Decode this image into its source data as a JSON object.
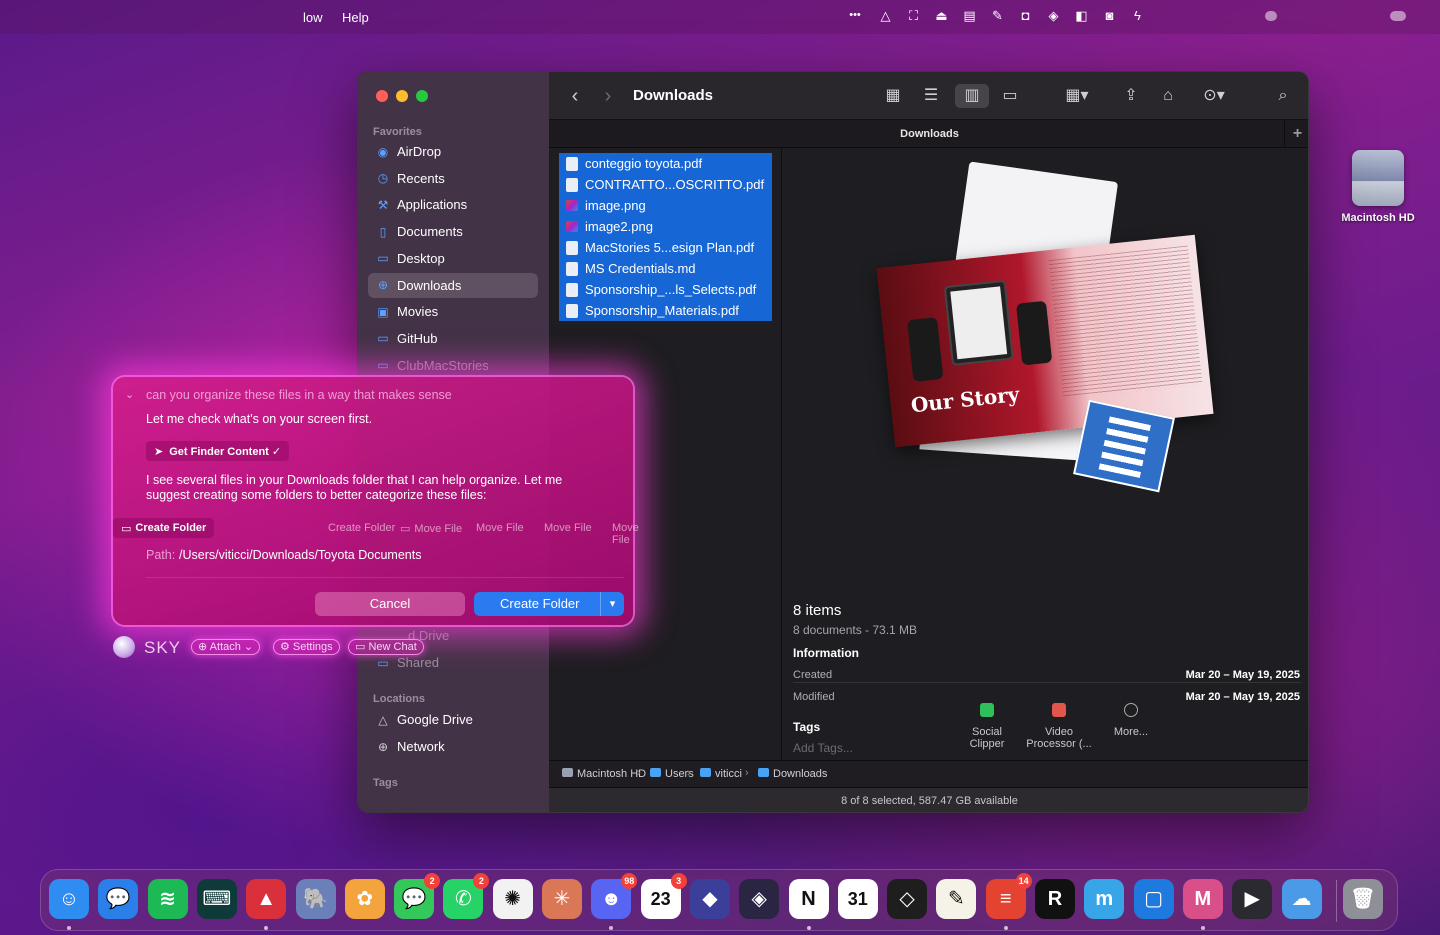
{
  "menubar": {
    "items": [
      "low",
      "Help"
    ],
    "status_icons": [
      "more-icon",
      "drive-icon",
      "screenshot-icon",
      "tray-icon",
      "clapper-icon",
      "pen-icon",
      "shield-icon",
      "layers-icon",
      "bag-icon",
      "camera-icon",
      "bolt-icon"
    ]
  },
  "finder": {
    "title": "Downloads",
    "tab_title": "Downloads",
    "tab_add": "+",
    "sidebar": {
      "favorites_label": "Favorites",
      "favorites": [
        {
          "label": "AirDrop",
          "icon": "airdrop-icon"
        },
        {
          "label": "Recents",
          "icon": "clock-icon"
        },
        {
          "label": "Applications",
          "icon": "applications-icon"
        },
        {
          "label": "Documents",
          "icon": "document-icon"
        },
        {
          "label": "Desktop",
          "icon": "desktop-icon"
        },
        {
          "label": "Downloads",
          "icon": "downloads-icon"
        },
        {
          "label": "Movies",
          "icon": "movies-icon"
        },
        {
          "label": "GitHub",
          "icon": "folder-icon"
        },
        {
          "label": "ClubMacStories",
          "icon": "folder-icon"
        }
      ],
      "partial_drive": "d Drive",
      "shared": "Shared",
      "locations_label": "Locations",
      "locations": [
        {
          "label": "Google Drive",
          "icon": "drive-icon"
        },
        {
          "label": "Network",
          "icon": "globe-icon"
        }
      ],
      "tags_label": "Tags"
    },
    "files": [
      {
        "name": "conteggio toyota.pdf",
        "kind": "pdf"
      },
      {
        "name": "CONTRATTO...OSCRITTO.pdf",
        "kind": "pdf"
      },
      {
        "name": "image.png",
        "kind": "img"
      },
      {
        "name": "image2.png",
        "kind": "img"
      },
      {
        "name": "MacStories 5...esign Plan.pdf",
        "kind": "pdf"
      },
      {
        "name": "MS Credentials.md",
        "kind": "pdf"
      },
      {
        "name": "Sponsorship_...ls_Selects.pdf",
        "kind": "pdf"
      },
      {
        "name": "Sponsorship_Materials.pdf",
        "kind": "pdf"
      }
    ],
    "preview": {
      "cover_title": "Our Story",
      "items_count": "8 items",
      "items_detail": "8 documents - 73.1 MB",
      "information_label": "Information",
      "created_label": "Created",
      "created_value": "Mar 20 – May 19, 2025",
      "modified_label": "Modified",
      "modified_value": "Mar 20 – May 19, 2025",
      "tags_label": "Tags",
      "tags_placeholder": "Add Tags...",
      "actions": [
        {
          "label1": "Social",
          "label2": "Clipper",
          "color": "#2fbf5b"
        },
        {
          "label1": "Video",
          "label2": "Processor (...",
          "color": "#e2554d"
        },
        {
          "label1": "More...",
          "label2": "",
          "color": "#8a8a8e"
        }
      ]
    },
    "path": [
      "Macintosh HD",
      "Users",
      "viticci",
      "Downloads"
    ],
    "status": "8 of 8 selected, 587.47 GB available"
  },
  "desktop": {
    "hd_label": "Macintosh HD"
  },
  "sky": {
    "prompt": "can you organize these files in a way that makes sense",
    "msg1": "Let me check what's on your screen first.",
    "tool_call": "Get Finder Content ✓",
    "msg2_line1": "I see several files in your Downloads folder that I can help organize. Let me",
    "msg2_line2": "suggest creating some folders to better categorize these files:",
    "actions": [
      "Create Folder",
      "Create Folder",
      "Move File",
      "Move File",
      "Move File",
      "Move File"
    ],
    "path_label": "Path:",
    "path_value": "/Users/viticci/Downloads/Toyota Documents",
    "cancel": "Cancel",
    "confirm": "Create Folder",
    "brand": "SKY",
    "attach": "Attach",
    "settings": "Settings",
    "new_chat": "New Chat"
  },
  "dock": {
    "apps": [
      {
        "name": "finder",
        "glyph": "☺",
        "color": "#2f8cf0"
      },
      {
        "name": "messages-alt",
        "glyph": "💬",
        "color": "#2a7fe8"
      },
      {
        "name": "spotify",
        "glyph": "≋",
        "color": "#1db954"
      },
      {
        "name": "terminal",
        "glyph": "⌨",
        "color": "#0f3a3a"
      },
      {
        "name": "git",
        "glyph": "▲",
        "color": "#d9303c"
      },
      {
        "name": "tableplus",
        "glyph": "🐘",
        "color": "#6b7fb8"
      },
      {
        "name": "photos",
        "glyph": "✿",
        "color": "#f3a43c"
      },
      {
        "name": "messages",
        "glyph": "💬",
        "color": "#34c759",
        "badge": "2"
      },
      {
        "name": "whatsapp",
        "glyph": "✆",
        "color": "#25d366",
        "badge": "2"
      },
      {
        "name": "chatgpt",
        "glyph": "✺",
        "color": "#f2f2f2"
      },
      {
        "name": "claude",
        "glyph": "✳",
        "color": "#d97757"
      },
      {
        "name": "discord",
        "glyph": "☻",
        "color": "#5865f2",
        "badge": "98"
      },
      {
        "name": "calendar",
        "glyph": "23",
        "color": "#ffffff",
        "badge": "3"
      },
      {
        "name": "shortcuts",
        "glyph": "◆",
        "color": "#3b3f9a"
      },
      {
        "name": "obsidian",
        "glyph": "◈",
        "color": "#2b2544"
      },
      {
        "name": "notion",
        "glyph": "N",
        "color": "#ffffff"
      },
      {
        "name": "fantastical",
        "glyph": "31",
        "color": "#ffffff"
      },
      {
        "name": "layers",
        "glyph": "◇",
        "color": "#1e1e1e"
      },
      {
        "name": "textedit",
        "glyph": "✎",
        "color": "#f5f2e8"
      },
      {
        "name": "todoist",
        "glyph": "≡",
        "color": "#e44332",
        "badge": "14"
      },
      {
        "name": "reeder",
        "glyph": "R",
        "color": "#111111"
      },
      {
        "name": "mela",
        "glyph": "m",
        "color": "#38a5e8"
      },
      {
        "name": "screens",
        "glyph": "▢",
        "color": "#1f7ae0"
      },
      {
        "name": "mimestream",
        "glyph": "M",
        "color": "#d94f8a"
      },
      {
        "name": "video",
        "glyph": "▶",
        "color": "#2a2a30"
      },
      {
        "name": "weather",
        "glyph": "☁",
        "color": "#4a9ae8"
      },
      {
        "name": "trash",
        "glyph": "🗑",
        "color": "#8f8f98"
      }
    ]
  }
}
